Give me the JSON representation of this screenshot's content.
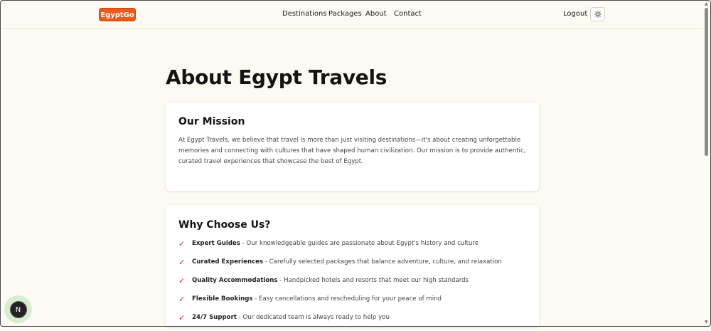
{
  "header": {
    "logo": "EgyptGo",
    "nav": [
      "Destinations",
      "Packages",
      "About",
      "Contact"
    ],
    "logout": "Logout",
    "theme_icon": "sun-icon"
  },
  "page": {
    "title": "About Egypt Travels"
  },
  "mission": {
    "title": "Our Mission",
    "text": "At Egypt Travels, we believe that travel is more than just visiting destinations—it's about creating unforgettable memories and connecting with cultures that have shaped human civilization. Our mission is to provide authentic, curated travel experiences that showcase the best of Egypt."
  },
  "why": {
    "title": "Why Choose Us?",
    "items": [
      {
        "bold": "Expert Guides",
        "text": " - Our knowledgeable guides are passionate about Egypt's history and culture"
      },
      {
        "bold": "Curated Experiences",
        "text": " - Carefully selected packages that balance adventure, culture, and relaxation"
      },
      {
        "bold": "Quality Accommodations",
        "text": " - Handpicked hotels and resorts that meet our high standards"
      },
      {
        "bold": "Flexible Bookings",
        "text": " - Easy cancellations and rescheduling for your peace of mind"
      },
      {
        "bold": "24/7 Support",
        "text": " - Our dedicated team is always ready to help you"
      }
    ]
  },
  "dev_badge": "N",
  "colors": {
    "accent": "#ea5a1b",
    "check": "#e02b1d",
    "background": "#fdfaf4"
  }
}
